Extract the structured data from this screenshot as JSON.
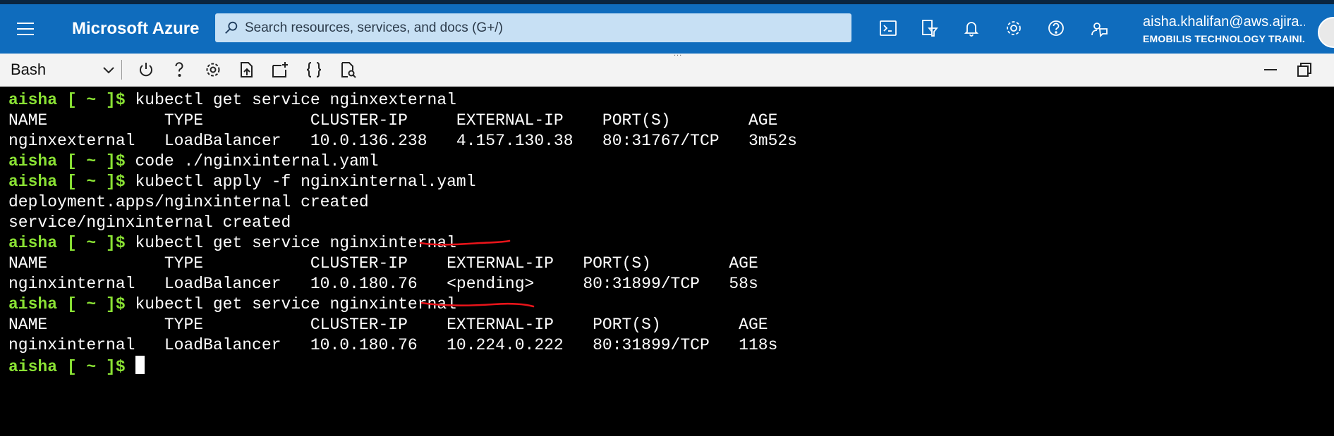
{
  "topbar": {
    "brand": "Microsoft Azure",
    "search_placeholder": "Search resources, services, and docs (G+/)",
    "user_email": "aisha.khalifan@aws.ajira...",
    "user_org": "EMOBILIS TECHNOLOGY TRAINI...",
    "icons": [
      "menu-icon",
      "cloud-shell-icon",
      "directory-filter-icon",
      "notifications-icon",
      "settings-icon",
      "help-icon",
      "feedback-icon"
    ]
  },
  "shell_toolbar": {
    "shell_type": "Bash",
    "buttons": [
      "restart-icon",
      "help-icon",
      "settings-icon",
      "upload-download-icon",
      "new-session-icon",
      "editor-icon",
      "web-preview-icon"
    ],
    "window_controls": [
      "minimize-icon",
      "maximize-icon"
    ]
  },
  "terminal": {
    "prompt": {
      "user": "aisha",
      "path": "[ ~ ]",
      "symbol": "$"
    },
    "lines": [
      {
        "type": "cmd",
        "text": " kubectl get service nginxexternal"
      },
      {
        "type": "out",
        "text": "NAME            TYPE           CLUSTER-IP     EXTERNAL-IP    PORT(S)        AGE"
      },
      {
        "type": "out",
        "text": "nginxexternal   LoadBalancer   10.0.136.238   4.157.130.38   80:31767/TCP   3m52s"
      },
      {
        "type": "cmd",
        "text": " code ./nginxinternal.yaml"
      },
      {
        "type": "cmd",
        "text": " kubectl apply -f nginxinternal.yaml"
      },
      {
        "type": "out",
        "text": "deployment.apps/nginxinternal created"
      },
      {
        "type": "out",
        "text": "service/nginxinternal created"
      },
      {
        "type": "cmd",
        "text": " kubectl get service nginxinternal"
      },
      {
        "type": "out",
        "text": "NAME            TYPE           CLUSTER-IP    EXTERNAL-IP   PORT(S)        AGE"
      },
      {
        "type": "out",
        "text": "nginxinternal   LoadBalancer   10.0.180.76   <pending>     80:31899/TCP   58s"
      },
      {
        "type": "cmd",
        "text": " kubectl get service nginxinternal"
      },
      {
        "type": "out",
        "text": "NAME            TYPE           CLUSTER-IP    EXTERNAL-IP    PORT(S)        AGE"
      },
      {
        "type": "out",
        "text": "nginxinternal   LoadBalancer   10.0.180.76   10.224.0.222   80:31899/TCP   118s"
      },
      {
        "type": "cmd",
        "text": " "
      }
    ]
  },
  "annotations": {
    "color": "#e8141a",
    "underlined": [
      "<pending>",
      "10.224.0.222"
    ]
  },
  "colors": {
    "azure_blue": "#0f6cbd",
    "prompt_green": "#8ae234",
    "terminal_bg": "#000000"
  }
}
